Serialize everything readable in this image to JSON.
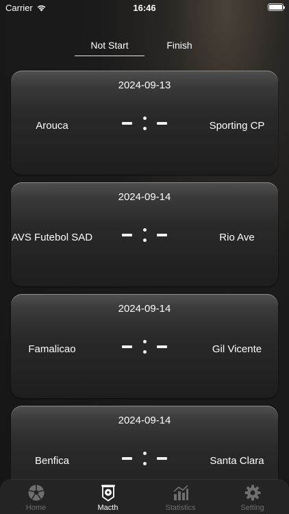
{
  "status_bar": {
    "carrier": "Carrier",
    "time": "16:46"
  },
  "tabs": {
    "not_start": "Not Start",
    "finish": "Finish"
  },
  "matches": [
    {
      "date": "2024-09-13",
      "home": "Arouca",
      "away": "Sporting CP"
    },
    {
      "date": "2024-09-14",
      "home": "AVS Futebol SAD",
      "away": "Rio Ave"
    },
    {
      "date": "2024-09-14",
      "home": "Famalicao",
      "away": "Gil Vicente"
    },
    {
      "date": "2024-09-14",
      "home": "Benfica",
      "away": "Santa Clara"
    }
  ],
  "tabbar": {
    "items": [
      {
        "label": "Home",
        "icon": "soccer-ball-icon"
      },
      {
        "label": "Macth",
        "icon": "banner-ball-icon"
      },
      {
        "label": "Statistics",
        "icon": "bar-chart-icon"
      },
      {
        "label": "Setting",
        "icon": "gear-icon"
      }
    ],
    "active_index": 1
  },
  "colors": {
    "active": "#ffffff",
    "inactive": "#6f6f6f",
    "card_top": "#505050",
    "card_bottom": "#1d1d1d"
  }
}
